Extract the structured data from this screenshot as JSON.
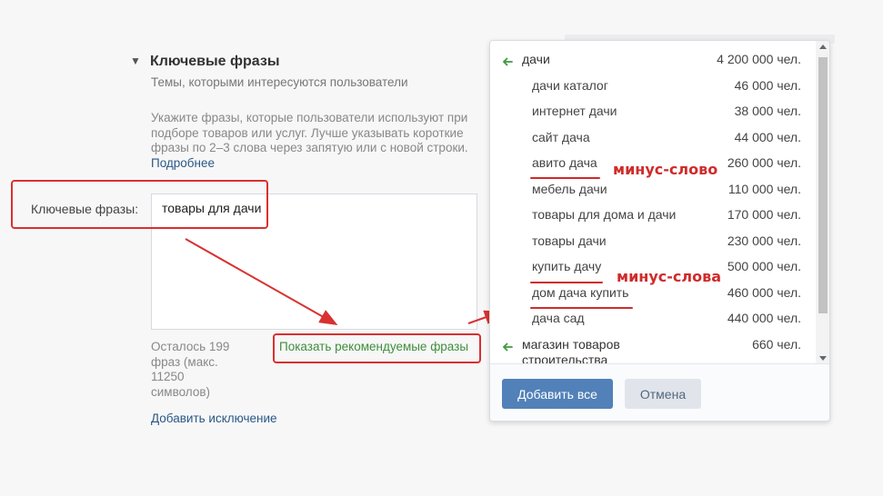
{
  "section": {
    "toggle_icon": "▼",
    "title": "Ключевые фразы",
    "subtitle": "Темы, которыми интересуются пользователи",
    "help_text": "Укажите фразы, которые пользователи используют при подборе товаров или услуг. Лучше указывать короткие фразы по 2–3 слова через запятую или с новой строки.",
    "help_link": "Подробнее"
  },
  "field": {
    "label": "Ключевые фразы:",
    "value": "товары для дачи"
  },
  "counter": "Осталось 199 фраз (макс. 11250 символов)",
  "show_recommended": "Показать рекомендуемые фразы",
  "add_exclusion": "Добавить исключение",
  "popup": {
    "rows": [
      {
        "type": "group",
        "phrase": "дачи",
        "count": "4 200 000 чел."
      },
      {
        "type": "child",
        "phrase": "дачи каталог",
        "count": "46 000 чел."
      },
      {
        "type": "child",
        "phrase": "интернет дачи",
        "count": "38 000 чел."
      },
      {
        "type": "child",
        "phrase": "сайт дача",
        "count": "44 000 чел."
      },
      {
        "type": "child",
        "phrase": "авито дача",
        "count": "260 000 чел."
      },
      {
        "type": "child",
        "phrase": "мебель дачи",
        "count": "110 000 чел."
      },
      {
        "type": "child",
        "phrase": "товары для дома и дачи",
        "count": "170 000 чел."
      },
      {
        "type": "child",
        "phrase": "товары дачи",
        "count": "230 000 чел."
      },
      {
        "type": "child",
        "phrase": "купить дачу",
        "count": "500 000 чел."
      },
      {
        "type": "child",
        "phrase": "дом дача купить",
        "count": "460 000 чел."
      },
      {
        "type": "child",
        "phrase": "дача сад",
        "count": "440 000 чел."
      },
      {
        "type": "group",
        "phrase": "магазин товаров строительства",
        "count": "660 чел."
      }
    ],
    "add_all": "Добавить все",
    "cancel": "Отмена"
  },
  "annotations": {
    "minus_word": "минус-слово",
    "minus_words": "минус-слова"
  },
  "colors": {
    "accent_button": "#5181b8",
    "link": "#2a5885",
    "green_link": "#3f8f3a",
    "annotation_red": "#d93030"
  },
  "icons": {
    "group_arrow": "left-arrow-icon",
    "section_toggle": "triangle-down-icon"
  }
}
